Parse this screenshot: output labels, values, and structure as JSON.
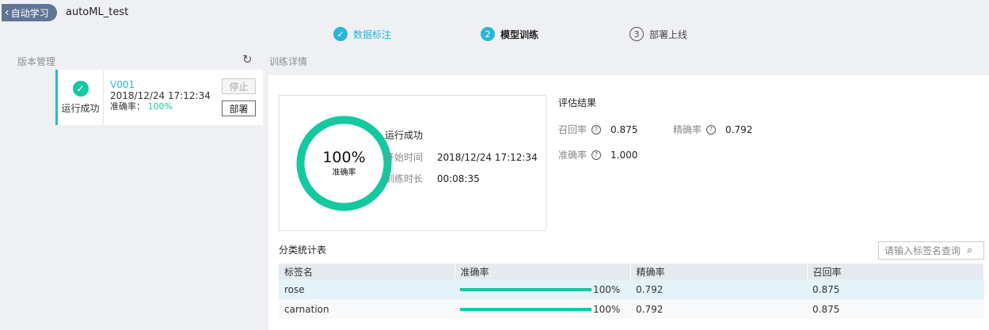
{
  "header": {
    "back_label": "自动学习",
    "title": "autoML_test"
  },
  "steps": [
    {
      "number": "",
      "label": "数据标注",
      "state": "done"
    },
    {
      "number": "2",
      "label": "模型训练",
      "state": "active"
    },
    {
      "number": "3",
      "label": "部署上线",
      "state": "todo"
    }
  ],
  "left_panel": {
    "title": "版本管理",
    "version": {
      "status": "运行成功",
      "name": "V001",
      "time": "2018/12/24 17:12:34",
      "accuracy_label": "准确率：",
      "accuracy_value": "100%",
      "stop_label": "停止",
      "deploy_label": "部署"
    }
  },
  "right_panel": {
    "title": "训练详情",
    "summary": {
      "ring_percent": "100%",
      "ring_label": "准确率",
      "ring_fraction": 1.0,
      "status": "运行成功",
      "start_label": "开始时间",
      "start_value": "2018/12/24 17:12:34",
      "duration_label": "训练时长",
      "duration_value": "00:08:35"
    },
    "eval": {
      "title": "评估结果",
      "recall_label": "召回率",
      "recall_value": "0.875",
      "precision_label": "精确率",
      "precision_value": "0.792",
      "accuracy_label": "准确率",
      "accuracy_value": "1.000"
    },
    "class_table": {
      "title": "分类统计表",
      "search_placeholder": "请输入标签名查询",
      "columns": [
        "标签名",
        "准确率",
        "精确率",
        "召回率"
      ],
      "rows": [
        {
          "label": "rose",
          "accuracy": "100%",
          "accuracy_fraction": 1.0,
          "precision": "0.792",
          "recall": "0.875"
        },
        {
          "label": "carnation",
          "accuracy": "100%",
          "accuracy_fraction": 1.0,
          "precision": "0.792",
          "recall": "0.875"
        }
      ]
    }
  },
  "colors": {
    "accent": "#2ab6d6",
    "success": "#14c9a0",
    "back_button": "#5f7596"
  }
}
